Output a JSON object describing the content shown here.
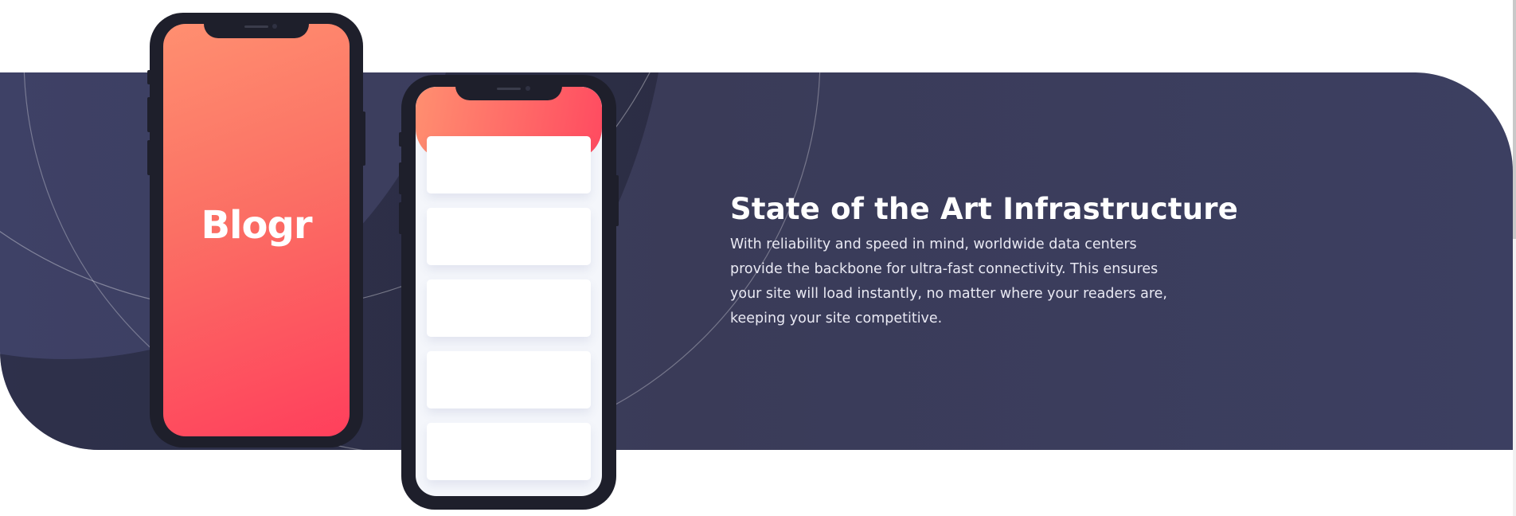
{
  "section": {
    "title": "State of the Art Infrastructure",
    "description": "With reliability and speed in mind, worldwide data centers provide the backbone for ultra-fast connectivity. This ensures your site will load instantly, no matter where your readers are, keeping your site competitive."
  },
  "phone_left": {
    "brand": "Blogr"
  },
  "phone_right": {
    "cards": [
      "",
      "",
      "",
      "",
      ""
    ]
  },
  "colors": {
    "band": "#3a3b58",
    "accent_start": "#ff8f70",
    "accent_end": "#ff3f5c",
    "phone_frame": "#1e1f2b",
    "text": "#ffffff"
  },
  "icons": [
    "phone-frame",
    "speaker",
    "camera"
  ]
}
